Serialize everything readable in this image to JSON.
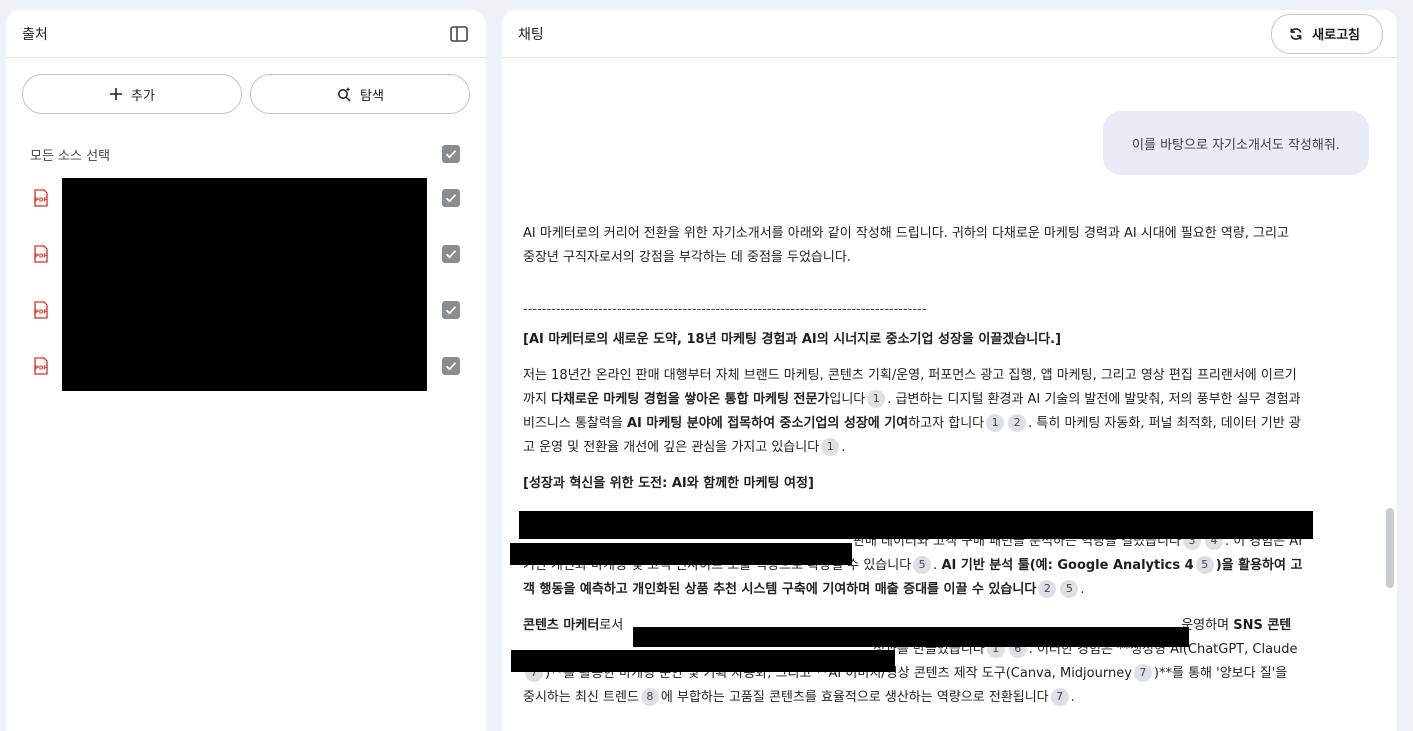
{
  "sources_panel": {
    "title": "출처",
    "add_label": "추가",
    "explore_label": "탐색",
    "select_all_label": "모든 소스 선택",
    "items": [
      {
        "icon": "pdf-icon",
        "checked": true
      },
      {
        "icon": "pdf-icon",
        "checked": true
      },
      {
        "icon": "pdf-icon",
        "checked": true
      },
      {
        "icon": "pdf-icon",
        "checked": true
      }
    ]
  },
  "chat_panel": {
    "title": "채팅",
    "refresh_label": "새로고침",
    "user_message": "이를 바탕으로 자기소개서도 작성해줘.",
    "answer": {
      "intro": "AI 마케터로의 커리어 전환을 위한 자기소개서를 아래와 같이 작성해 드립니다. 귀하의 다채로운 마케팅 경력과 AI 시대에 필요한 역량, 그리고 중장년 구직자로서의 강점을 부각하는 데 중점을 두었습니다.",
      "divider": "--------------------------------------------------------------------------------------",
      "heading1": "[AI 마케터로의 새로운 도약, 18년 마케팅 경험과 AI의 시너지로 중소기업 성장을 이끌겠습니다.]",
      "p1": {
        "a": "저는 18년간 온라인 판매 대행부터 자체 브랜드 마케팅, 콘텐츠 기획/운영, 퍼포먼스 광고 집행, 앱 마케팅, 그리고 영상 편집 프리랜서에 이르기까지 ",
        "b_bold": "다채로운 마케팅 경험을 쌓아온 통합 마케팅 전문가",
        "c": "입니다",
        "d": ". 급변하는 디지털 환경과 AI 기술의 발전에 발맞춰, 저의 풍부한 실무 경험과 비즈니스 통찰력을 ",
        "e_bold": "AI 마케팅 분야에 접목하여 중소기업의 성장에 기여",
        "f": "하고자 합니다",
        "g": ". 특히 마케팅 자동화, 퍼널 최적화, 데이터 기반 광고 운영 및 전환율 개선에 깊은 관심을 가지고 있습니다",
        "h": "."
      },
      "heading2": "[성장과 혁신을 위한 도전: AI와 함께한 마케팅 여정]",
      "p2": {
        "a": "판매 데이터와 고객 구매 패턴을 분석하는 역량을 길렀습니다",
        "b": ". 이 경험은 AI 기반 개인화 마케팅 및 고객 인사이트 도출 역량으로 확장될 수 있습니다",
        "c": ". ",
        "d_bold": "AI 기반 분석 툴(예: Google Analytics 4",
        "e_bold": ")을 활용하여 고객 행동을 예측하고 개인화된 상품 추천 시스템 구축에 기여하며 매출 증대를 이끌 수 있습니다",
        "f": "."
      },
      "p3": {
        "a_bold": "콘텐츠 마케터",
        "b": "로서",
        "c": "운영하며 ",
        "d_bold": "SNS 콘텐",
        "e": "성과를 만들었습니다",
        "f": ". 이러한 경험은 **생성형 AI(ChatGPT, Claude",
        "g": ")**를 활용한 마케팅 문안 및 기획 자동화, 그리고 **AI 이미지/영상 콘텐츠 제작 도구(Canva, Midjourney",
        "h": ")**를 통해 '양보다 질'을 중시하는 최신 트렌드",
        "i": "에 부합하는 고품질 콘텐츠를 효율적으로 생산하는 역량으로 전환됩니다",
        "j": "."
      },
      "citations": {
        "c1": "1",
        "c2": "2",
        "c3": "3",
        "c4": "4",
        "c5": "5",
        "c6": "6",
        "c7": "7",
        "c8": "8"
      }
    }
  }
}
